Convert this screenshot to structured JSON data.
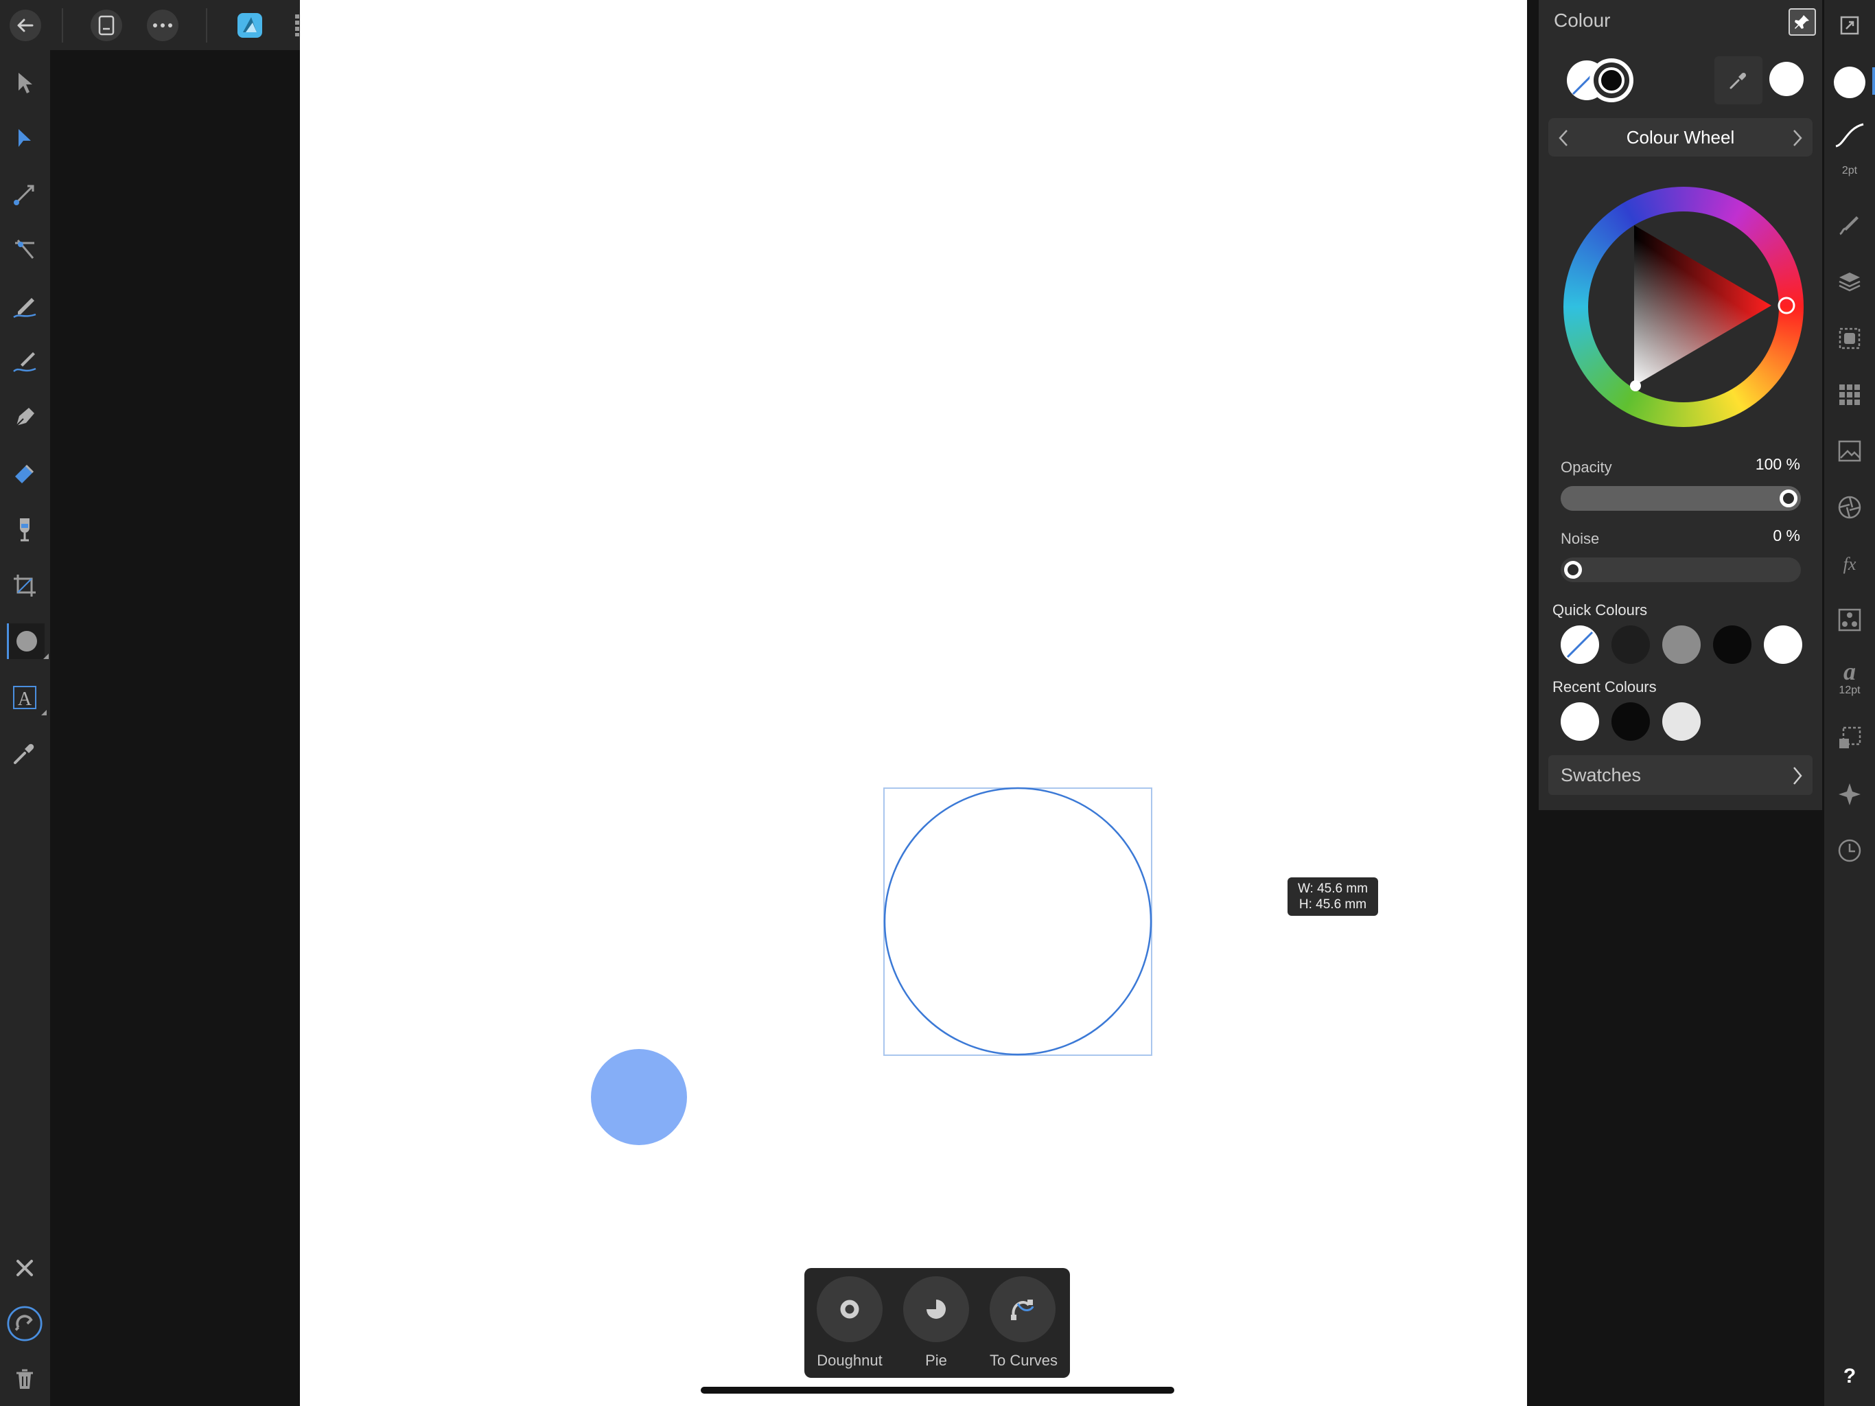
{
  "panel": {
    "title": "Colour",
    "mode_label": "Colour Wheel",
    "opacity_label": "Opacity",
    "opacity_value": "100 %",
    "opacity_fraction": 1.0,
    "noise_label": "Noise",
    "noise_value": "0 %",
    "noise_fraction": 0.0,
    "quick_colours_label": "Quick Colours",
    "quick_colours": [
      "none",
      "#1e1e1e",
      "#8c8c8c",
      "#0a0a0a",
      "#ffffff"
    ],
    "recent_colours_label": "Recent Colours",
    "recent_colours": [
      "#ffffff",
      "#0a0a0a",
      "#e6e6e6"
    ],
    "swatches_label": "Swatches",
    "fill_colour": "#ffffff"
  },
  "studio": {
    "stroke_width": "2pt",
    "text_size": "12pt",
    "help": "?"
  },
  "canvas": {
    "size_tooltip_w": "W: 45.6 mm",
    "size_tooltip_h": "H: 45.6 mm",
    "selected_stroke_colour": "#3b79d6",
    "small_circle_colour": "#85aef7"
  },
  "context_toolbar": {
    "items": [
      {
        "label": "Doughnut",
        "icon": "doughnut-icon"
      },
      {
        "label": "Pie",
        "icon": "pie-icon"
      },
      {
        "label": "To Curves",
        "icon": "to-curves-icon"
      }
    ]
  },
  "accent_colour": "#4ab6ea"
}
